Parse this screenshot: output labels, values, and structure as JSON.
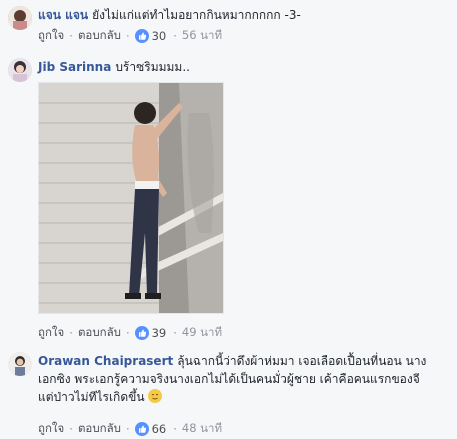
{
  "comments": [
    {
      "author": "แจน แจน",
      "text": "ยังไม่แก่แต่ทำไมอยากกินหมากกกกก -3-",
      "like_label": "ถูกใจ",
      "reply_label": "ตอบกลับ",
      "reactions": "30",
      "time": "56 นาที"
    },
    {
      "author": "Jib Sarinna",
      "text": "บร้าซริมมมม..",
      "like_label": "ถูกใจ",
      "reply_label": "ตอบกลับ",
      "reactions": "39",
      "time": "49 นาที"
    },
    {
      "author": "Orawan Chaiprasert",
      "text": "ลุ้นฉากนี้ว่าดึงผ้าห่มมา เจอเลือดเปื้อนที่นอน นางเอกซิง พระเอกรู้ความจริงนางเอกไม่ได้เป็นคนมั่วผู้ชาย เค้าคือคนแรกของจี แต่ป่าวไม่ทีไรเกิดขึ้น",
      "like_label": "ถูกใจ",
      "reply_label": "ตอบกลับ",
      "reactions": "66",
      "time": "48 นาที"
    }
  ],
  "colors": {
    "author": "#365899",
    "meta": "#90949c",
    "like_badge": "#5890ff",
    "background": "#f6f7f9"
  }
}
